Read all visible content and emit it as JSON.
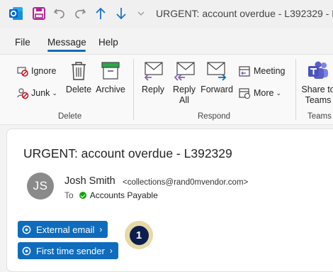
{
  "window": {
    "title": "URGENT: account overdue - L392329  -  M",
    "colors": {
      "accent": "#0f6cbd",
      "outlook": "#0a64c8",
      "save": "#b4229a",
      "teams": "#5b5fc7"
    },
    "icons": [
      "outlook-icon",
      "save-icon",
      "undo-icon",
      "redo-icon",
      "up-arrow-icon",
      "down-arrow-icon",
      "customize-chevron-icon"
    ]
  },
  "menu": {
    "file": "File",
    "message": "Message",
    "help": "Help"
  },
  "ribbon": {
    "delete_group": {
      "label": "Delete",
      "ignore": "Ignore",
      "junk": "Junk",
      "delete": "Delete",
      "archive": "Archive"
    },
    "respond_group": {
      "label": "Respond",
      "reply": "Reply",
      "reply_all_line1": "Reply",
      "reply_all_line2": "All",
      "forward": "Forward",
      "meeting": "Meeting",
      "more": "More"
    },
    "teams_group": {
      "label": "Teams",
      "share_line1": "Share to",
      "share_line2": "Teams"
    }
  },
  "email": {
    "subject": "URGENT: account overdue - L392329",
    "sender_initials": "JS",
    "sender_name": "Josh Smith",
    "sender_email": "<collections@rand0mvendor.com>",
    "to_label": "To",
    "to_name": "Accounts Payable",
    "tags": [
      "External email",
      "First time sender"
    ],
    "callout_number": "1"
  }
}
